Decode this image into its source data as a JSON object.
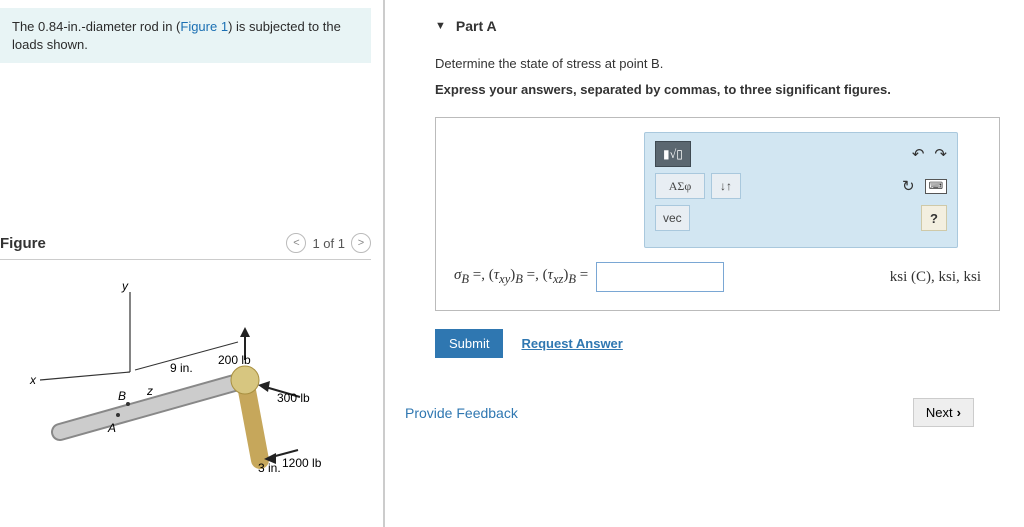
{
  "problem": {
    "text_pre": "The ",
    "diameter": "0.84-in.",
    "text_mid": "-diameter rod in (",
    "figure_link": "Figure 1",
    "text_post": ") is subjected to the loads shown."
  },
  "figure": {
    "heading": "Figure",
    "nav_prev": "<",
    "counter": "1 of 1",
    "nav_next": ">",
    "labels": {
      "y": "y",
      "x": "x",
      "z": "z",
      "A": "A",
      "B": "B",
      "len1": "9 in.",
      "len2": "3 in.",
      "f1": "200 lb",
      "f2": "300 lb",
      "f3": "1200 lb"
    }
  },
  "part": {
    "title": "Part A",
    "instruction": "Determine the state of stress at point B.",
    "subinstruction": "Express your answers, separated by commas, to three significant figures."
  },
  "toolbar": {
    "templ": "▮√▯",
    "greek": "ΑΣφ",
    "updown": "↓↑",
    "vec": "vec",
    "undo": "↶",
    "redo": "↷",
    "reset": "↻",
    "keyboard": "⌨",
    "help": "?"
  },
  "answer": {
    "lhs": "σB =, (τxy)B =, (τxz)B =",
    "value": "",
    "units": "ksi (C), ksi, ksi"
  },
  "buttons": {
    "submit": "Submit",
    "request": "Request Answer",
    "feedback": "Provide Feedback",
    "next": "Next"
  }
}
